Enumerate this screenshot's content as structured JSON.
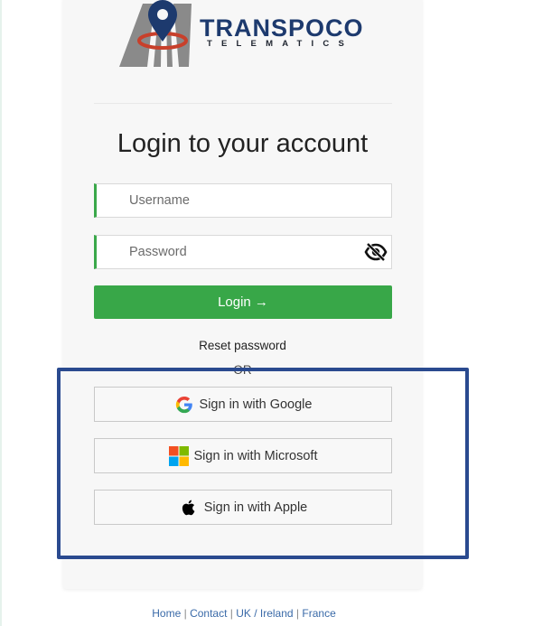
{
  "brand": {
    "wordmark": "TRANSPOCO",
    "subtitle": "TELEMATICS"
  },
  "login": {
    "title": "Login to your account",
    "username_placeholder": "Username",
    "password_placeholder": "Password",
    "login_label": "Login →",
    "reset_label": "Reset password",
    "or_label": "OR"
  },
  "sso": {
    "google_label": "Sign in with Google",
    "microsoft_label": "Sign in with Microsoft",
    "apple_label": "Sign in with Apple"
  },
  "footer": {
    "links": [
      "Home",
      "Contact",
      "UK / Ireland",
      "France"
    ],
    "separator": " | "
  },
  "colors": {
    "accent": "#38a748",
    "brand_navy": "#1d3a6e",
    "highlight": "#2a4a8f",
    "logo_pin_ring": "#c8402b"
  },
  "icons": {
    "password_toggle": "eye-slash-icon",
    "google": "google-g-icon",
    "microsoft": "microsoft-squares-icon",
    "apple": "apple-icon"
  }
}
